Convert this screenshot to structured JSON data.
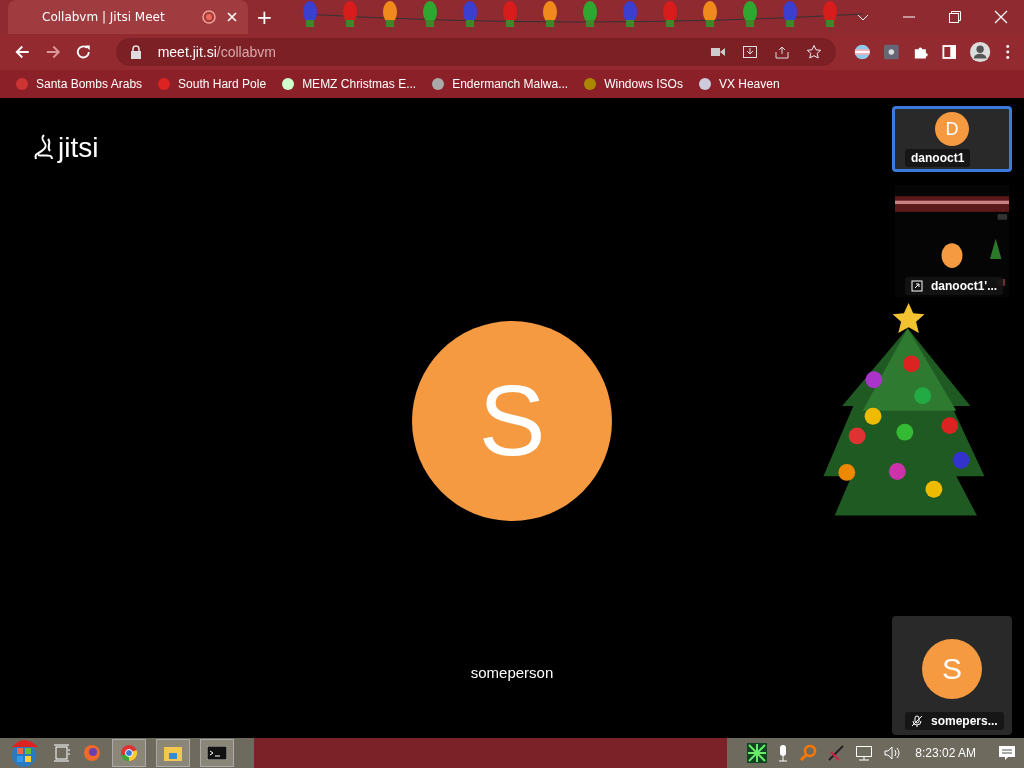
{
  "browser": {
    "tab": {
      "title": "Collabvm | Jitsi Meet",
      "recording": true
    },
    "new_tab": "+",
    "url": {
      "host": "meet.jit.si",
      "path": "/collabvm"
    },
    "bookmarks": [
      {
        "label": "Santa Bombs Arabs"
      },
      {
        "label": "South Hard Pole"
      },
      {
        "label": "MEMZ Christmas E..."
      },
      {
        "label": "Endermanch Malwa..."
      },
      {
        "label": "Windows ISOs"
      },
      {
        "label": "VX Heaven"
      }
    ]
  },
  "meeting": {
    "logo": "jitsi",
    "main": {
      "initial": "S",
      "name": "someperson"
    },
    "thumbnails": [
      {
        "kind": "avatar",
        "initial": "D",
        "name": "danooct1",
        "selected": true,
        "muted": false
      },
      {
        "kind": "screen",
        "name": "danooct1'...",
        "selected": false,
        "muted": false
      },
      {
        "kind": "avatar",
        "initial": "S",
        "name": "somepers...",
        "selected": false,
        "muted": true
      }
    ]
  },
  "taskbar": {
    "clock": "8:23:02 AM"
  }
}
